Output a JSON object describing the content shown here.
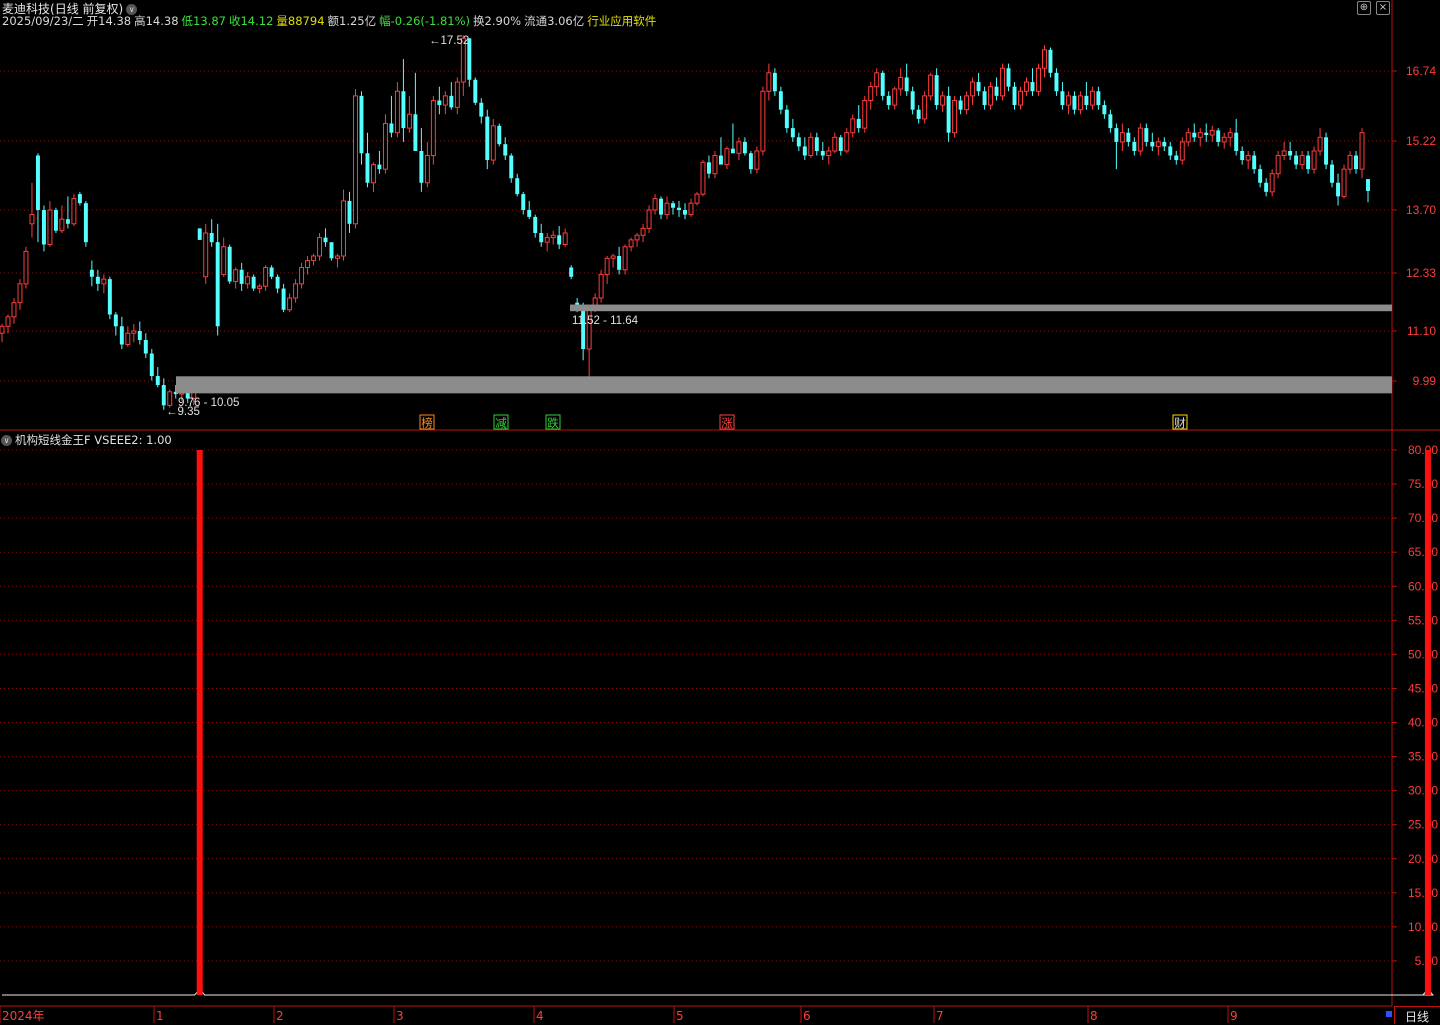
{
  "title": {
    "stock": "麦迪科技",
    "mode": "(日线 前复权)"
  },
  "quote": {
    "date": "2025/09/23/二",
    "open_label": "开",
    "open": "14.38",
    "high_label": "高",
    "high": "14.38",
    "low_label": "低",
    "low": "13.87",
    "close_label": "收",
    "close": "14.12",
    "vol_label": "量",
    "vol": "88794",
    "amount_label": "额",
    "amount": "1.25亿",
    "chg_label": "幅",
    "chg": "-0.26(-1.81%)",
    "turnover_label": "换",
    "turnover": "2.90%",
    "float_label": "流通",
    "float": "3.06亿",
    "industry": "行业应用软件"
  },
  "price_axis": [
    "16.74",
    "15.22",
    "13.70",
    "12.33",
    "11.10",
    "9.99"
  ],
  "annotations": {
    "high_label": "17.52",
    "low_label": "9.35",
    "zone1": "9.76 - 10.05",
    "zone2": "11.52 - 11.64"
  },
  "events": [
    {
      "text": "榜",
      "color": "#ff8a1c",
      "border": "#ff8a1c"
    },
    {
      "text": "减",
      "color": "#34d234",
      "border": "#34d234"
    },
    {
      "text": "跌",
      "color": "#34d234",
      "border": "#34d234"
    },
    {
      "text": "涨",
      "color": "#ff4040",
      "border": "#ff4040"
    },
    {
      "text": "财",
      "color": "#e0e0e0",
      "border": "#ffd700"
    }
  ],
  "indicator": {
    "name": "机构短线金王F",
    "var": "VSEEE2: 1.00"
  },
  "indicator_axis": [
    "80.00",
    "75.00",
    "70.00",
    "65.00",
    "60.00",
    "55.00",
    "50.00",
    "45.00",
    "40.00",
    "35.00",
    "30.00",
    "25.00",
    "20.00",
    "15.00",
    "10.00",
    "5.00"
  ],
  "time_axis": [
    "2024年",
    "1",
    "2",
    "3",
    "4",
    "5",
    "6",
    "7",
    "8",
    "9"
  ],
  "period_label": "日线",
  "colors": {
    "up": "#ff3c3c",
    "down": "#54ffff",
    "grid": "#8a1010",
    "axis": "#c01010",
    "zone": "#8c8c8c",
    "yellow": "#e0e000",
    "green": "#3ce03c",
    "signal": "#ff1010"
  },
  "chart_data": {
    "type": "candlestick",
    "price_range": [
      9.35,
      17.52
    ],
    "candles": [
      [
        11.05,
        11.25,
        10.85,
        11.2
      ],
      [
        11.2,
        11.45,
        11.05,
        11.4
      ],
      [
        11.4,
        11.8,
        11.25,
        11.7
      ],
      [
        11.7,
        12.2,
        11.55,
        12.1
      ],
      [
        12.1,
        12.9,
        12.0,
        12.8
      ],
      [
        13.4,
        14.3,
        13.1,
        13.6
      ],
      [
        14.9,
        14.95,
        13.0,
        13.7
      ],
      [
        13.7,
        13.8,
        12.8,
        12.95
      ],
      [
        12.95,
        13.9,
        12.9,
        13.7
      ],
      [
        13.7,
        13.75,
        13.2,
        13.25
      ],
      [
        13.25,
        13.8,
        13.2,
        13.5
      ],
      [
        13.5,
        14.0,
        13.3,
        13.4
      ],
      [
        13.4,
        14.05,
        13.35,
        13.95
      ],
      [
        14.05,
        14.1,
        13.8,
        13.85
      ],
      [
        13.85,
        13.9,
        12.9,
        13.0
      ],
      [
        12.4,
        12.6,
        12.05,
        12.25
      ],
      [
        12.25,
        12.4,
        11.95,
        12.1
      ],
      [
        12.1,
        12.3,
        11.9,
        12.2
      ],
      [
        12.2,
        12.25,
        11.35,
        11.45
      ],
      [
        11.45,
        11.5,
        11.0,
        11.2
      ],
      [
        11.2,
        11.4,
        10.7,
        10.8
      ],
      [
        10.8,
        11.2,
        10.75,
        11.05
      ],
      [
        11.05,
        11.25,
        10.85,
        11.1
      ],
      [
        11.1,
        11.3,
        10.8,
        10.9
      ],
      [
        10.9,
        11.05,
        10.5,
        10.6
      ],
      [
        10.6,
        10.7,
        10.0,
        10.1
      ],
      [
        10.1,
        10.3,
        9.85,
        9.9
      ],
      [
        9.9,
        10.05,
        9.35,
        9.45
      ],
      [
        9.45,
        9.8,
        9.4,
        9.75
      ],
      [
        9.75,
        9.9,
        9.6,
        9.7
      ],
      [
        9.7,
        9.95,
        9.55,
        9.85
      ],
      [
        9.85,
        9.9,
        9.5,
        9.6
      ],
      [
        9.6,
        9.8,
        9.45,
        9.75
      ],
      [
        13.3,
        13.3,
        13.05,
        13.05
      ],
      [
        12.25,
        13.4,
        12.1,
        13.2
      ],
      [
        13.2,
        13.5,
        12.9,
        13.0
      ],
      [
        13.0,
        13.4,
        11.0,
        11.2
      ],
      [
        12.3,
        13.1,
        12.25,
        12.9
      ],
      [
        12.9,
        12.95,
        12.1,
        12.15
      ],
      [
        12.15,
        12.45,
        12.0,
        12.4
      ],
      [
        12.4,
        12.55,
        11.95,
        12.1
      ],
      [
        12.1,
        12.35,
        12.0,
        12.25
      ],
      [
        12.25,
        12.3,
        11.95,
        12.0
      ],
      [
        12.0,
        12.1,
        11.9,
        12.05
      ],
      [
        12.05,
        12.5,
        11.95,
        12.45
      ],
      [
        12.45,
        12.5,
        12.2,
        12.25
      ],
      [
        12.25,
        12.3,
        11.9,
        12.0
      ],
      [
        12.0,
        12.1,
        11.5,
        11.55
      ],
      [
        11.55,
        11.9,
        11.5,
        11.8
      ],
      [
        11.8,
        12.2,
        11.7,
        12.1
      ],
      [
        12.1,
        12.55,
        12.0,
        12.45
      ],
      [
        12.45,
        12.7,
        12.3,
        12.6
      ],
      [
        12.6,
        12.75,
        12.5,
        12.7
      ],
      [
        12.7,
        13.2,
        12.6,
        13.1
      ],
      [
        13.1,
        13.3,
        12.9,
        13.0
      ],
      [
        13.0,
        12.95,
        12.6,
        12.65
      ],
      [
        12.65,
        12.75,
        12.45,
        12.7
      ],
      [
        12.7,
        14.15,
        12.6,
        13.9
      ],
      [
        13.9,
        14.1,
        13.2,
        13.4
      ],
      [
        13.4,
        16.35,
        13.3,
        16.2
      ],
      [
        16.2,
        16.3,
        14.7,
        14.95
      ],
      [
        14.95,
        15.4,
        14.2,
        14.3
      ],
      [
        14.3,
        14.75,
        14.1,
        14.7
      ],
      [
        14.7,
        15.0,
        14.5,
        14.6
      ],
      [
        14.6,
        15.8,
        14.5,
        15.6
      ],
      [
        15.6,
        16.2,
        15.3,
        15.4
      ],
      [
        15.4,
        16.5,
        15.3,
        16.3
      ],
      [
        16.3,
        17.0,
        15.2,
        15.5
      ],
      [
        15.5,
        16.2,
        15.4,
        15.8
      ],
      [
        15.8,
        16.7,
        15.6,
        15.0
      ],
      [
        15.0,
        15.5,
        14.1,
        14.3
      ],
      [
        14.3,
        15.2,
        14.2,
        14.9
      ],
      [
        14.9,
        16.2,
        14.7,
        16.1
      ],
      [
        16.1,
        16.4,
        15.8,
        16.0
      ],
      [
        16.0,
        16.3,
        15.8,
        16.2
      ],
      [
        16.2,
        16.5,
        15.9,
        15.95
      ],
      [
        15.95,
        16.6,
        15.8,
        16.5
      ],
      [
        16.5,
        17.52,
        16.2,
        17.45
      ],
      [
        17.45,
        17.45,
        16.4,
        16.55
      ],
      [
        16.55,
        16.6,
        16.0,
        16.05
      ],
      [
        16.05,
        16.15,
        15.6,
        15.75
      ],
      [
        15.75,
        15.9,
        14.6,
        14.8
      ],
      [
        14.8,
        15.7,
        14.7,
        15.55
      ],
      [
        15.55,
        15.6,
        15.1,
        15.15
      ],
      [
        15.15,
        15.3,
        14.8,
        14.9
      ],
      [
        14.9,
        14.95,
        14.3,
        14.4
      ],
      [
        14.4,
        14.5,
        14.0,
        14.05
      ],
      [
        14.05,
        14.1,
        13.6,
        13.7
      ],
      [
        13.7,
        13.9,
        13.5,
        13.55
      ],
      [
        13.55,
        13.6,
        13.1,
        13.2
      ],
      [
        13.2,
        13.4,
        12.9,
        13.0
      ],
      [
        13.0,
        13.2,
        12.8,
        13.1
      ],
      [
        13.1,
        13.25,
        12.95,
        13.15
      ],
      [
        13.15,
        13.35,
        12.85,
        12.95
      ],
      [
        12.95,
        13.3,
        12.9,
        13.2
      ],
      [
        12.45,
        12.5,
        12.2,
        12.25
      ],
      [
        11.7,
        11.8,
        11.5,
        11.55
      ],
      [
        11.55,
        11.7,
        10.45,
        10.7
      ],
      [
        10.7,
        11.65,
        10.0,
        11.55
      ],
      [
        11.55,
        11.9,
        11.5,
        11.8
      ],
      [
        11.8,
        12.4,
        11.7,
        12.3
      ],
      [
        12.3,
        12.7,
        12.1,
        12.65
      ],
      [
        12.65,
        12.75,
        12.45,
        12.7
      ],
      [
        12.7,
        12.9,
        12.3,
        12.4
      ],
      [
        12.4,
        12.95,
        12.3,
        12.9
      ],
      [
        12.9,
        13.1,
        12.8,
        13.05
      ],
      [
        13.05,
        13.2,
        12.9,
        13.15
      ],
      [
        13.15,
        13.4,
        13.0,
        13.3
      ],
      [
        13.3,
        13.8,
        13.2,
        13.7
      ],
      [
        13.7,
        14.05,
        13.6,
        13.95
      ],
      [
        13.95,
        14.0,
        13.5,
        13.6
      ],
      [
        13.6,
        14.0,
        13.5,
        13.85
      ],
      [
        13.85,
        13.9,
        13.6,
        13.75
      ],
      [
        13.75,
        13.9,
        13.55,
        13.7
      ],
      [
        13.7,
        13.85,
        13.5,
        13.6
      ],
      [
        13.6,
        13.95,
        13.55,
        13.85
      ],
      [
        13.85,
        14.1,
        13.8,
        14.05
      ],
      [
        14.05,
        14.8,
        14.0,
        14.75
      ],
      [
        14.75,
        14.9,
        14.4,
        14.5
      ],
      [
        14.5,
        15.0,
        14.4,
        14.9
      ],
      [
        14.9,
        15.3,
        14.8,
        14.7
      ],
      [
        14.7,
        15.1,
        14.6,
        15.05
      ],
      [
        15.05,
        15.6,
        14.95,
        14.95
      ],
      [
        14.95,
        15.3,
        14.8,
        15.2
      ],
      [
        15.2,
        15.3,
        14.9,
        14.95
      ],
      [
        14.95,
        15.0,
        14.5,
        14.6
      ],
      [
        14.6,
        15.1,
        14.5,
        15.0
      ],
      [
        15.0,
        16.4,
        14.9,
        16.3
      ],
      [
        16.3,
        16.9,
        16.1,
        16.7
      ],
      [
        16.7,
        16.8,
        16.2,
        16.3
      ],
      [
        16.3,
        16.4,
        15.8,
        15.9
      ],
      [
        15.9,
        16.0,
        15.4,
        15.5
      ],
      [
        15.5,
        15.7,
        15.2,
        15.3
      ],
      [
        15.3,
        15.4,
        15.0,
        15.1
      ],
      [
        15.1,
        15.3,
        14.8,
        14.9
      ],
      [
        14.9,
        15.4,
        14.85,
        15.3
      ],
      [
        15.3,
        15.4,
        14.9,
        15.0
      ],
      [
        15.0,
        15.2,
        14.8,
        14.9
      ],
      [
        14.9,
        15.1,
        14.7,
        15.0
      ],
      [
        15.0,
        15.4,
        14.95,
        15.3
      ],
      [
        15.3,
        15.35,
        14.9,
        15.0
      ],
      [
        15.0,
        15.5,
        14.95,
        15.4
      ],
      [
        15.4,
        15.8,
        15.3,
        15.7
      ],
      [
        15.7,
        16.0,
        15.4,
        15.5
      ],
      [
        15.5,
        16.2,
        15.4,
        16.1
      ],
      [
        16.1,
        16.5,
        15.9,
        16.4
      ],
      [
        16.4,
        16.8,
        16.2,
        16.7
      ],
      [
        16.7,
        16.75,
        16.1,
        16.2
      ],
      [
        16.2,
        16.3,
        15.9,
        16.0
      ],
      [
        16.0,
        16.4,
        15.9,
        16.35
      ],
      [
        16.35,
        16.8,
        16.2,
        16.6
      ],
      [
        16.6,
        16.9,
        16.2,
        16.3
      ],
      [
        16.3,
        16.4,
        15.8,
        15.9
      ],
      [
        15.9,
        16.0,
        15.6,
        15.7
      ],
      [
        15.7,
        16.3,
        15.6,
        16.2
      ],
      [
        16.2,
        16.7,
        16.1,
        16.65
      ],
      [
        16.65,
        16.8,
        15.9,
        16.0
      ],
      [
        16.0,
        16.3,
        15.85,
        16.2
      ],
      [
        16.2,
        16.4,
        15.2,
        15.4
      ],
      [
        15.4,
        16.2,
        15.3,
        16.1
      ],
      [
        16.1,
        16.2,
        15.8,
        15.9
      ],
      [
        15.9,
        16.3,
        15.8,
        16.2
      ],
      [
        16.2,
        16.6,
        16.0,
        16.5
      ],
      [
        16.5,
        16.7,
        16.2,
        16.3
      ],
      [
        16.3,
        16.4,
        15.9,
        16.0
      ],
      [
        16.0,
        16.5,
        15.9,
        16.4
      ],
      [
        16.4,
        16.6,
        16.1,
        16.2
      ],
      [
        16.2,
        16.9,
        16.1,
        16.8
      ],
      [
        16.8,
        16.9,
        16.3,
        16.4
      ],
      [
        16.4,
        16.5,
        15.9,
        16.0
      ],
      [
        16.0,
        16.4,
        15.9,
        16.3
      ],
      [
        16.3,
        16.6,
        16.2,
        16.5
      ],
      [
        16.5,
        16.8,
        16.2,
        16.3
      ],
      [
        16.3,
        16.9,
        16.2,
        16.8
      ],
      [
        16.8,
        17.3,
        16.6,
        17.2
      ],
      [
        17.2,
        17.25,
        16.6,
        16.7
      ],
      [
        16.7,
        16.8,
        16.2,
        16.3
      ],
      [
        16.3,
        16.5,
        15.9,
        16.0
      ],
      [
        16.0,
        16.3,
        15.8,
        16.2
      ],
      [
        16.2,
        16.3,
        15.8,
        15.9
      ],
      [
        15.9,
        16.3,
        15.8,
        16.2
      ],
      [
        16.2,
        16.5,
        15.9,
        16.0
      ],
      [
        16.0,
        16.4,
        15.9,
        16.3
      ],
      [
        16.3,
        16.4,
        15.9,
        16.0
      ],
      [
        16.0,
        16.1,
        15.7,
        15.8
      ],
      [
        15.8,
        15.9,
        15.4,
        15.5
      ],
      [
        15.5,
        15.6,
        14.6,
        15.2
      ],
      [
        15.2,
        15.6,
        15.0,
        15.4
      ],
      [
        15.4,
        15.5,
        15.1,
        15.2
      ],
      [
        15.2,
        15.3,
        14.9,
        15.0
      ],
      [
        15.0,
        15.6,
        14.9,
        15.5
      ],
      [
        15.5,
        15.6,
        15.1,
        15.2
      ],
      [
        15.2,
        15.4,
        15.0,
        15.1
      ],
      [
        15.1,
        15.3,
        14.9,
        15.2
      ],
      [
        15.2,
        15.3,
        15.0,
        15.1
      ],
      [
        15.1,
        15.2,
        14.8,
        14.9
      ],
      [
        14.9,
        15.0,
        14.7,
        14.8
      ],
      [
        14.8,
        15.3,
        14.7,
        15.2
      ],
      [
        15.2,
        15.5,
        15.1,
        15.4
      ],
      [
        15.4,
        15.6,
        15.2,
        15.3
      ],
      [
        15.3,
        15.5,
        15.1,
        15.4
      ],
      [
        15.4,
        15.6,
        15.2,
        15.35
      ],
      [
        15.35,
        15.55,
        15.2,
        15.45
      ],
      [
        15.45,
        15.5,
        15.1,
        15.2
      ],
      [
        15.2,
        15.4,
        15.05,
        15.3
      ],
      [
        15.3,
        15.5,
        15.1,
        15.4
      ],
      [
        15.4,
        15.7,
        14.9,
        15.0
      ],
      [
        15.0,
        15.1,
        14.7,
        14.8
      ],
      [
        14.8,
        15.0,
        14.6,
        14.9
      ],
      [
        14.9,
        15.0,
        14.5,
        14.6
      ],
      [
        14.6,
        14.7,
        14.2,
        14.3
      ],
      [
        14.3,
        14.4,
        14.0,
        14.1
      ],
      [
        14.1,
        14.6,
        14.0,
        14.5
      ],
      [
        14.5,
        15.0,
        14.4,
        14.9
      ],
      [
        14.9,
        15.2,
        14.8,
        15.0
      ],
      [
        15.0,
        15.2,
        14.8,
        14.9
      ],
      [
        14.9,
        15.0,
        14.6,
        14.7
      ],
      [
        14.7,
        15.0,
        14.6,
        14.9
      ],
      [
        14.9,
        15.0,
        14.5,
        14.6
      ],
      [
        14.6,
        15.1,
        14.5,
        15.0
      ],
      [
        15.0,
        15.5,
        14.9,
        15.3
      ],
      [
        15.3,
        15.4,
        14.6,
        14.7
      ],
      [
        14.7,
        14.8,
        14.2,
        14.3
      ],
      [
        14.3,
        14.5,
        13.8,
        14.0
      ],
      [
        14.0,
        14.7,
        13.95,
        14.6
      ],
      [
        14.6,
        15.0,
        14.5,
        14.9
      ],
      [
        14.9,
        15.0,
        14.5,
        14.6
      ],
      [
        14.6,
        15.5,
        14.4,
        15.4
      ],
      [
        14.38,
        14.38,
        13.87,
        14.12
      ]
    ],
    "zones": [
      {
        "label": "9.76 - 10.05",
        "low": 9.76,
        "high": 10.05
      },
      {
        "label": "11.52 - 11.64",
        "low": 11.52,
        "high": 11.64
      }
    ],
    "indicator": {
      "name": "VSEEE2",
      "value": 1.0,
      "y_range": [
        0,
        80
      ],
      "signal_indices": [
        33,
        238
      ],
      "signal_value": 80
    }
  }
}
